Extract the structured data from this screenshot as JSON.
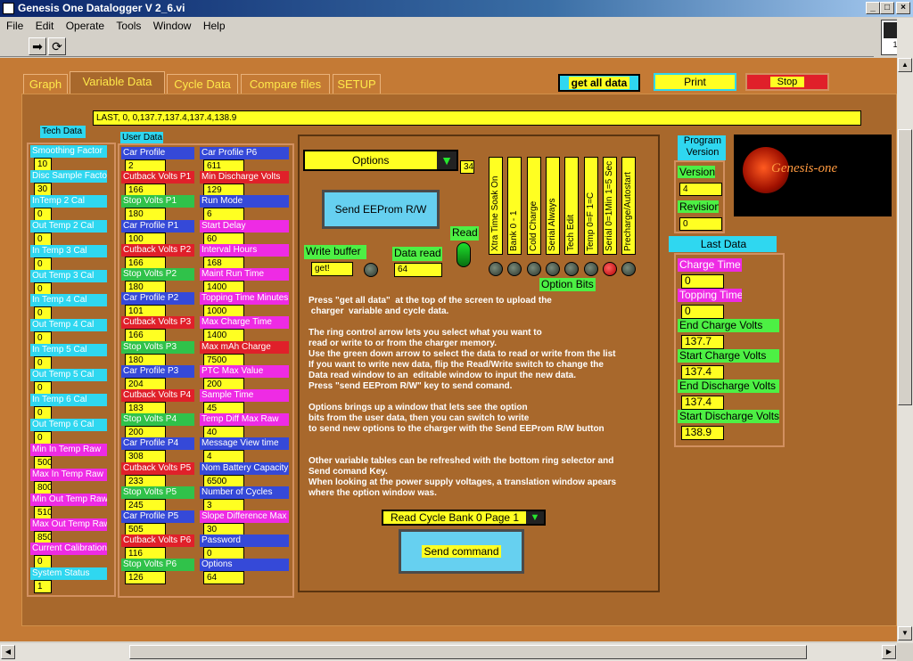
{
  "window": {
    "title": "Genesis One Datalogger V 2_6.vi"
  },
  "menu": [
    "File",
    "Edit",
    "Operate",
    "Tools",
    "Window",
    "Help"
  ],
  "tabs": [
    "Graph",
    "Variable Data",
    "Cycle Data",
    "Compare files",
    "SETUP"
  ],
  "buttons": {
    "get_all": "get all  data",
    "print": "Print",
    "stop": "Stop"
  },
  "vi_icon_label": "1",
  "status_line": "LAST,   0,   0,137.7,137.4,137.4,138.9",
  "tech": {
    "title": "Tech Data",
    "items": [
      {
        "label": "Smoothing Factor",
        "value": "10"
      },
      {
        "label": "Disc Sample Factor",
        "value": "30"
      },
      {
        "label": "InTemp 2 Cal",
        "value": "0"
      },
      {
        "label": "Out Temp 2 Cal",
        "value": "0"
      },
      {
        "label": "In Temp 3 Cal",
        "value": "0"
      },
      {
        "label": "Out Temp 3 Cal",
        "value": "0"
      },
      {
        "label": "In Temp 4 Cal",
        "value": "0"
      },
      {
        "label": "Out Temp 4 Cal",
        "value": "0"
      },
      {
        "label": "In Temp 5 Cal",
        "value": "0"
      },
      {
        "label": "Out Temp 5 Cal",
        "value": "0"
      },
      {
        "label": "In Temp 6 Cal",
        "value": "0"
      },
      {
        "label": "Out Temp 6 Cal",
        "value": "0"
      },
      {
        "label": "Min In Temp Raw",
        "value": "500"
      },
      {
        "label": "Max In Temp Raw",
        "value": "800"
      },
      {
        "label": "Min Out Temp Raw",
        "value": "510"
      },
      {
        "label": "Max Out Temp Raw",
        "value": "850"
      },
      {
        "label": "Current Calibration",
        "value": "0"
      },
      {
        "label": "System Status",
        "value": "1"
      }
    ]
  },
  "user": {
    "title": "User Data",
    "col1": [
      {
        "label": "Car Profile",
        "value": "2"
      },
      {
        "label": "Cutback Volts P1",
        "value": "166"
      },
      {
        "label": "Stop Volts P1",
        "value": "180"
      },
      {
        "label": "Car Profile P1",
        "value": "100"
      },
      {
        "label": "Cutback Volts P2",
        "value": "166"
      },
      {
        "label": "Stop Volts P2",
        "value": "180"
      },
      {
        "label": "Car Profile P2",
        "value": "101"
      },
      {
        "label": "Cutback Volts P3",
        "value": "166"
      },
      {
        "label": "Stop Volts P3",
        "value": "180"
      },
      {
        "label": "Car Profile P3",
        "value": "204"
      },
      {
        "label": "Cutback Volts P4",
        "value": "183"
      },
      {
        "label": "Stop Volts P4",
        "value": "200"
      },
      {
        "label": "Car Profile P4",
        "value": "308"
      },
      {
        "label": "Cutback Volts P5",
        "value": "233"
      },
      {
        "label": "Stop Volts P5",
        "value": "245"
      },
      {
        "label": "Car Profile P5",
        "value": "505"
      },
      {
        "label": "Cutback Volts P6",
        "value": "116"
      },
      {
        "label": "Stop Volts P6",
        "value": "126"
      }
    ],
    "col2": [
      {
        "label": "Car Profile P6",
        "value": "611"
      },
      {
        "label": "Min Discharge Volts",
        "value": "129"
      },
      {
        "label": "Run Mode",
        "value": "6"
      },
      {
        "label": "Start Delay",
        "value": "60"
      },
      {
        "label": "Interval Hours",
        "value": "168"
      },
      {
        "label": "Maint Run Time",
        "value": "1400"
      },
      {
        "label": "Topping Time Minutes",
        "value": "1000"
      },
      {
        "label": "Max Charge Time",
        "value": "1400"
      },
      {
        "label": "Max mAh Charge",
        "value": "7500"
      },
      {
        "label": "PTC Max Value",
        "value": "200"
      },
      {
        "label": "Sample Time",
        "value": "45"
      },
      {
        "label": "Temp Diff  Max Raw",
        "value": "40"
      },
      {
        "label": "Message View time",
        "value": "4"
      },
      {
        "label": "Nom Battery Capacity",
        "value": "6500"
      },
      {
        "label": "Number of Cycles",
        "value": "3"
      },
      {
        "label": "Slope Difference Max",
        "value": "30"
      },
      {
        "label": "Password",
        "value": "0"
      },
      {
        "label": "Options",
        "value": "64"
      }
    ]
  },
  "middle": {
    "options_ring": "Options",
    "options_index": "34",
    "send_eeprom": "Send EEProm R/W",
    "write_buffer_label": "Write buffer",
    "write_buffer_value": "get!",
    "data_read_label": "Data read",
    "data_read_value": "64",
    "read_label": "Read",
    "option_bits_title": "Option Bits",
    "option_bits": [
      "Xtra Time Soak On",
      "Bank 0 - 1",
      "Cold Charge",
      "Serial Always",
      "Tech Edit",
      "Temp 0=F 1=C",
      "Serial 0=1Min 1=5 Sec",
      "Precharge/Autostart"
    ],
    "instructions": "Press \"get all data\"  at the top of the screen to upload the\n charger  variable and cycle data.\n\nThe ring control arrow lets you select what you want to\nread or write to or from the charger memory.\nUse the green down arrow to select the data to read or write from the list\nIf you want to write new data, flip the Read/Write switch to change the\nData read window to an  editable window to input the new data.\nPress \"send EEProm R/W\" key to send comand.\n\nOptions brings up a window that lets see the option\nbits from the user data, then you can switch to write\nto send new options to the charger with the Send EEProm R/W button\n\n\nOther variable tables can be refreshed with the bottom ring selector and\nSend comand Key.\nWhen looking at the power supply voltages, a translation window apears\nwhere the option window was.",
    "cycle_ring": "Read Cycle Bank 0 Page  1",
    "send_command": "Send command"
  },
  "right": {
    "program_version_label": "Program Version",
    "version_label": "Version",
    "version_value": "4",
    "revision_label": "Revision",
    "revision_value": "0",
    "logo_text": "Genesis-one",
    "last_data_title": "Last Data",
    "last_data": [
      {
        "label": "Charge Time",
        "value": "0"
      },
      {
        "label": "Topping Time",
        "value": "0"
      },
      {
        "label": "End Charge Volts",
        "value": "137.7"
      },
      {
        "label": "Start Charge Volts",
        "value": "137.4"
      },
      {
        "label": "End Discharge Volts",
        "value": "137.4"
      },
      {
        "label": "Start Discharge Volts",
        "value": "138.9"
      }
    ]
  }
}
